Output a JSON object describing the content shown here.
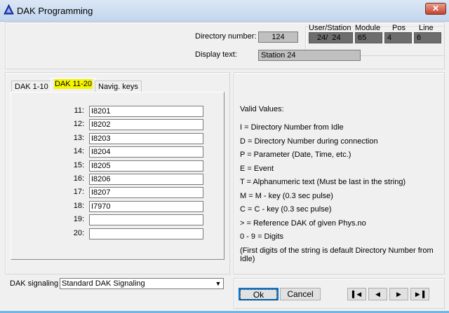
{
  "window": {
    "title": "DAK Programming",
    "close": "✕"
  },
  "header": {
    "directory_label": "Directory number:",
    "directory_value": "124",
    "display_label": "Display text:",
    "display_value": "Station 24",
    "user_station_label": "User/Station",
    "user_station_value": "24/  24",
    "module_label": "Module",
    "module_value": "65",
    "pos_label": "Pos",
    "pos_value": "4",
    "line_label": "Line",
    "line_value": "6"
  },
  "tabs": [
    {
      "label": "DAK 1-10"
    },
    {
      "label": "DAK 11-20"
    },
    {
      "label": "Navig. keys"
    }
  ],
  "rows": [
    {
      "n": "11:",
      "v": "I8201"
    },
    {
      "n": "12:",
      "v": "I8202"
    },
    {
      "n": "13:",
      "v": "I8203"
    },
    {
      "n": "14:",
      "v": "I8204"
    },
    {
      "n": "15:",
      "v": "I8205"
    },
    {
      "n": "16:",
      "v": "I8206"
    },
    {
      "n": "17:",
      "v": "I8207"
    },
    {
      "n": "18:",
      "v": "I7970"
    },
    {
      "n": "19:",
      "v": ""
    },
    {
      "n": "20:",
      "v": ""
    }
  ],
  "signaling": {
    "label": "DAK signaling",
    "value": "Standard DAK Signaling"
  },
  "valid": [
    "Valid Values:",
    "I = Directory Number from Idle",
    "D = Directory Number during connection",
    "P = Parameter (Date, Time, etc.)",
    "E = Event",
    "T = Alphanumeric text (Must be last in the string)",
    "M = M - key (0.3 sec pulse)",
    "C = C - key (0.3 sec pulse)",
    "> = Reference DAK of given Phys.no",
    "0 - 9 = Digits",
    "(First digits of the string is default Directory Number from Idle)"
  ],
  "buttons": {
    "ok": "Ok",
    "cancel": "Cancel"
  },
  "highlight_color": "#f5f500"
}
